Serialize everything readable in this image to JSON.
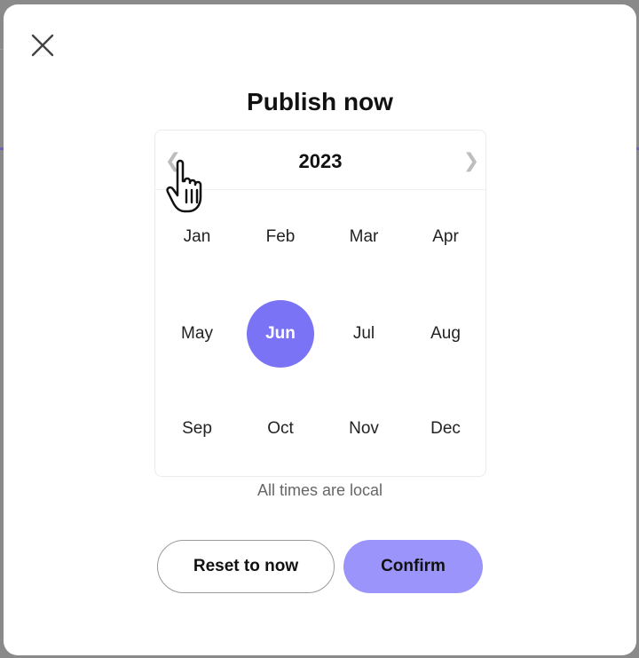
{
  "modal": {
    "title": "Publish now",
    "close_icon": "close-icon"
  },
  "calendar": {
    "year": "2023",
    "prev_icon": "chevron-left-icon",
    "next_icon": "chevron-right-icon",
    "prev_glyph": "❮",
    "next_glyph": "❯",
    "months": [
      "Jan",
      "Feb",
      "Mar",
      "Apr",
      "May",
      "Jun",
      "Jul",
      "Aug",
      "Sep",
      "Oct",
      "Nov",
      "Dec"
    ],
    "selected_month": "Jun",
    "accent_color": "#7b73f6"
  },
  "note": "All times are local",
  "buttons": {
    "reset_label": "Reset to now",
    "confirm_label": "Confirm",
    "confirm_color": "#9b95fb"
  },
  "cursor_icon": "hand-pointer-icon"
}
